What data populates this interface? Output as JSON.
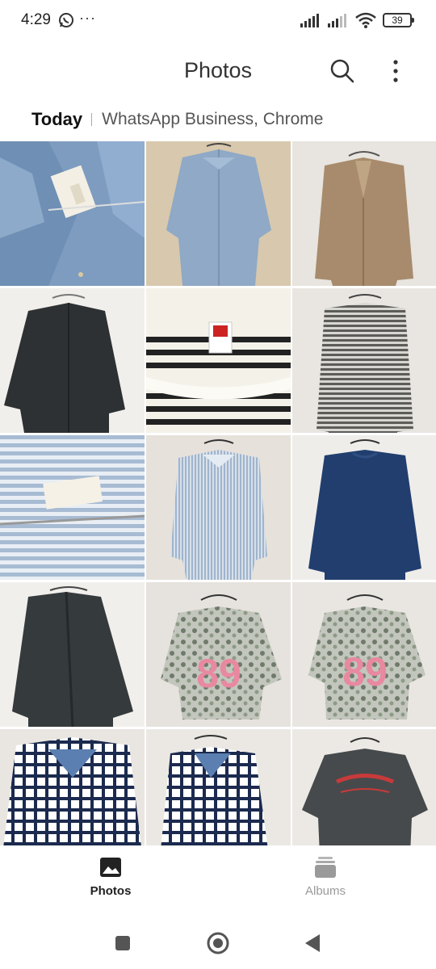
{
  "status": {
    "time": "4:29",
    "battery": "39",
    "overflow": "···"
  },
  "app": {
    "title": "Photos",
    "icons": [
      "search-icon",
      "more-vertical-icon"
    ]
  },
  "section": {
    "date": "Today",
    "sources": "WhatsApp Business, Chrome"
  },
  "photos": [
    {
      "subject": "denim shirt collar with H&M tag"
    },
    {
      "subject": "light blue button shirt on hanger"
    },
    {
      "subject": "tan cardigan on hanger"
    },
    {
      "subject": "black button shirt"
    },
    {
      "subject": "striped shirt collar with Uniqlo tag"
    },
    {
      "subject": "grey striped long sleeve top"
    },
    {
      "subject": "blue striped shirt with H&M tag"
    },
    {
      "subject": "light blue striped shirt"
    },
    {
      "subject": "navy long sleeve top"
    },
    {
      "subject": "dark grey open shirt"
    },
    {
      "subject": "floral print tee with 89"
    },
    {
      "subject": "floral print tee with 89"
    },
    {
      "subject": "navy white check shirt"
    },
    {
      "subject": "navy white check shirt"
    },
    {
      "subject": "charcoal graphic tee"
    }
  ],
  "bottom_nav": {
    "photos_label": "Photos",
    "albums_label": "Albums"
  },
  "system_nav": [
    "recents-square-icon",
    "home-circle-icon",
    "back-triangle-icon"
  ],
  "colors": {
    "accent": "#222222",
    "inactive": "#9a9a9a"
  }
}
